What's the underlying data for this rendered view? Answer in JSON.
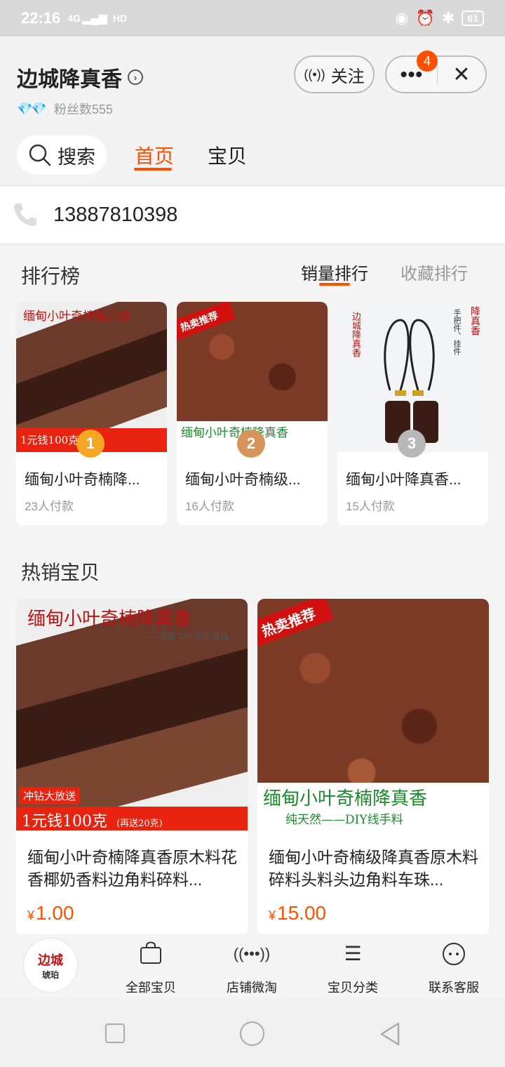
{
  "status": {
    "time": "22:16",
    "signal": "4G",
    "hd": "HD",
    "battery": "61"
  },
  "shop": {
    "name": "边城降真香",
    "fans_label": "粉丝数555",
    "follow_label": "关注",
    "notif_count": "4"
  },
  "tabs": {
    "search": "搜索",
    "home": "首页",
    "items": "宝贝"
  },
  "contact": {
    "phone": "13887810398"
  },
  "ranking": {
    "title": "排行榜",
    "tab_sales": "销量排行",
    "tab_fav": "收藏排行",
    "items": [
      {
        "name": "缅甸小叶奇楠降...",
        "sold": "23人付款",
        "rank": "1"
      },
      {
        "name": "缅甸小叶奇楠级...",
        "sold": "16人付款",
        "rank": "2"
      },
      {
        "name": "缅甸小叶降真香...",
        "sold": "15人付款",
        "rank": "3"
      }
    ]
  },
  "hot": {
    "title": "热销宝贝",
    "items": [
      {
        "title": "缅甸小叶奇楠降真香原木料花香椰奶香料边角料碎料...",
        "currency": "¥",
        "price": "1.00"
      },
      {
        "title": "缅甸小叶奇楠级降真香原木料碎料头料头边角料车珠...",
        "currency": "¥",
        "price": "15.00"
      }
    ]
  },
  "images": {
    "headline": "缅甸小叶奇楠降真香",
    "sub": "——燃香·DIY 仿形首选",
    "hot_tag": "热卖推荐",
    "promo": "冲钻大放送",
    "promo_price": "1元钱100克",
    "promo_extra": "(再送20克)",
    "pure": "纯天然——DIY线手料",
    "pendant_title": "降真香",
    "pendant_sub": "手把件、挂件",
    "pendant_brand": "边城降真香"
  },
  "bottom_nav": {
    "logo": "边城",
    "logo_sub": "琥珀",
    "items": [
      "全部宝贝",
      "店铺微淘",
      "宝贝分类",
      "联系客服"
    ]
  },
  "colors": {
    "accent": "#ff5000",
    "gold": "#f5a623",
    "silver": "#b8b8b8",
    "bronze": "#d6935a"
  }
}
